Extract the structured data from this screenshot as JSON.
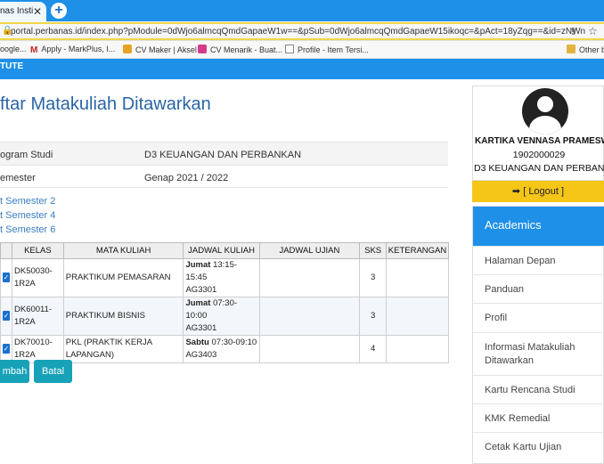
{
  "browser": {
    "tab_title": "nas Insti",
    "tab_close": "✕",
    "new_tab": "+",
    "url": "portal.perbanas.id/index.php?pModule=0dWjo6almcqQmdGapaeW1w==&pSub=0dWjo6almcqQmdGapaeW15ikoqc=&pAct=18yZqg==&id=zNWn",
    "bookmarks": [
      "oogle...",
      "Apply - MarkPlus, I...",
      "CV Maker | Aksel",
      "CV Menarik - Buat...",
      "Profile - Item Tersi...",
      "Other b"
    ]
  },
  "site": {
    "brand": "TUTE"
  },
  "page": {
    "title": "ftar Matakuliah Ditawarkan",
    "info": [
      {
        "label": "ogram Studi",
        "value": "D3 KEUANGAN DAN PERBANKAN"
      },
      {
        "label": "emester",
        "value": "Genap 2021 / 2022"
      }
    ],
    "semester_links": [
      "t Semester 2",
      "t Semester 4",
      "t Semester 6"
    ]
  },
  "table": {
    "headers": [
      "",
      "KELAS",
      "MATA KULIAH",
      "JADWAL KULIAH",
      "JADWAL UJIAN",
      "SKS",
      "KETERANGAN"
    ],
    "rows": [
      {
        "kelas_1": "DK50030-",
        "kelas_2": "1R2A",
        "mk_1": "PRAKTIKUM PEMASARAN",
        "mk_2": "",
        "day": "Jumat",
        "time": "13:15-15:45",
        "room": "AG3301",
        "ujian": "",
        "sks": "3",
        "ket": ""
      },
      {
        "kelas_1": "DK60011-",
        "kelas_2": "1R2A",
        "mk_1": "PRAKTIKUM BISNIS",
        "mk_2": "",
        "day": "Jumat",
        "time": "07:30-10:00",
        "room": "AG3301",
        "ujian": "",
        "sks": "3",
        "ket": ""
      },
      {
        "kelas_1": "DK70010-",
        "kelas_2": "1R2A",
        "mk_1": "PKL (PRAKTIK KERJA",
        "mk_2": "LAPANGAN)",
        "day": "Sabtu",
        "time": "07:30-09:10",
        "room": "AG3403",
        "ujian": "",
        "sks": "4",
        "ket": ""
      }
    ]
  },
  "buttons": {
    "tambah": "mbah",
    "batal": "Batal"
  },
  "sidebar": {
    "name": "KARTIKA VENNASA PRAMESW",
    "nim": "1902000029",
    "program": "D3 KEUANGAN DAN PERBANK",
    "logout_icon": "➡",
    "logout": "[ Logout ]",
    "menu_title": "Academics",
    "menu": [
      "Halaman Depan",
      "Panduan",
      "Profil",
      "Informasi Matakuliah Ditawarkan",
      "Kartu Rencana Studi",
      "KMK Remedial",
      "Cetak Kartu Ujian"
    ]
  },
  "colors": {
    "accent": "#1e90e8",
    "title": "#2a64a6",
    "button": "#17a2b8",
    "logout": "#f5c518",
    "link": "#3a7fc4"
  }
}
